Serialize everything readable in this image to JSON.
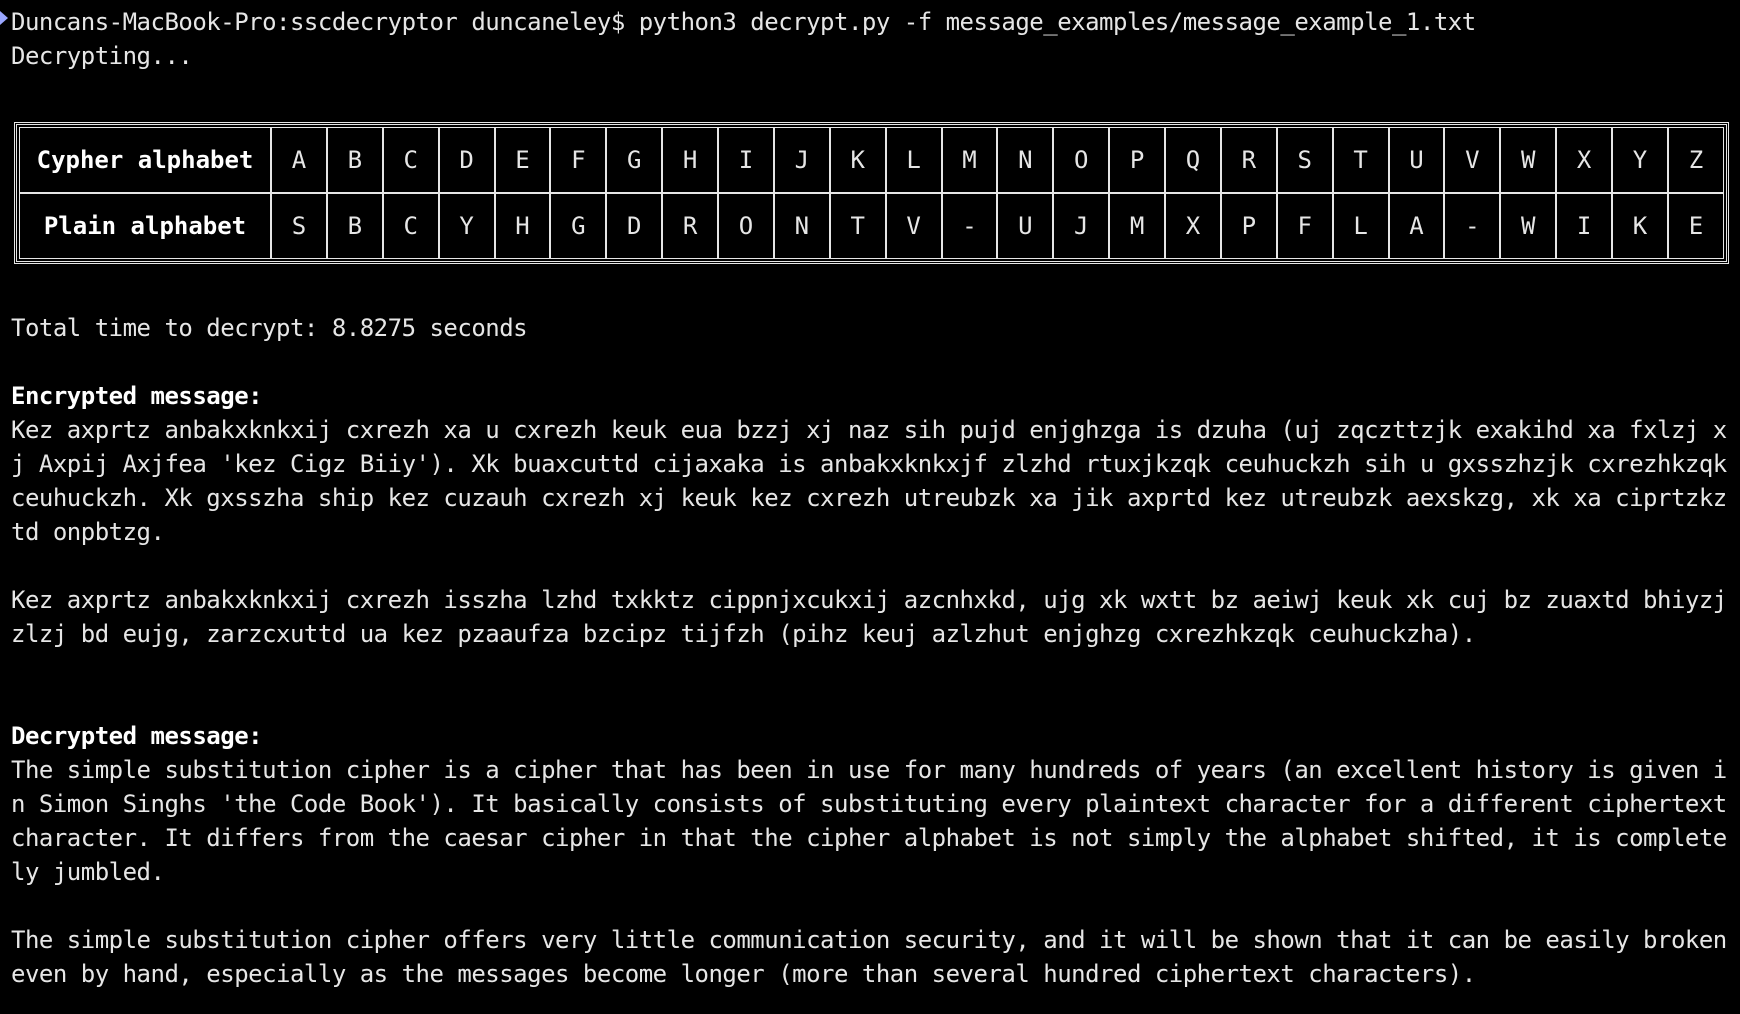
{
  "terminal": {
    "prompt": "Duncans-MacBook-Pro:sscdecryptor duncaneley$ python3 decrypt.py -f message_examples/message_example_1.txt",
    "status": "Decrypting...",
    "table": {
      "row1_label": "Cypher alphabet",
      "row2_label": "Plain alphabet",
      "cypher": [
        "A",
        "B",
        "C",
        "D",
        "E",
        "F",
        "G",
        "H",
        "I",
        "J",
        "K",
        "L",
        "M",
        "N",
        "O",
        "P",
        "Q",
        "R",
        "S",
        "T",
        "U",
        "V",
        "W",
        "X",
        "Y",
        "Z"
      ],
      "plain": [
        "S",
        "B",
        "C",
        "Y",
        "H",
        "G",
        "D",
        "R",
        "O",
        "N",
        "T",
        "V",
        "-",
        "U",
        "J",
        "M",
        "X",
        "P",
        "F",
        "L",
        "A",
        "-",
        "W",
        "I",
        "K",
        "E"
      ]
    },
    "total_time": "Total time to decrypt: 8.8275 seconds",
    "encrypted_heading": "Encrypted message:",
    "encrypted_p1": "Kez axprtz anbakxknkxij cxrezh xa u cxrezh keuk eua bzzj xj naz sih pujd enjghzga is dzuha (uj zqczttzjk exakihd xa fxlzj xj Axpij Axjfea 'kez Cigz Biiy'). Xk buaxcuttd cijaxaka is anbakxknkxjf zlzhd rtuxjkzqk ceuhuckzh sih u gxsszhzjk cxrezhkzqk ceuhuckzh. Xk gxsszha ship kez cuzauh cxrezh xj keuk kez cxrezh utreubzk xa jik axprtd kez utreubzk aexskzg, xk xa ciprtzkztd onpbtzg.",
    "encrypted_p2": "Kez axprtz anbakxknkxij cxrezh isszha lzhd txkktz cippnjxcukxij azcnhxkd, ujg xk wxtt bz aeiwj keuk xk cuj bz zuaxtd bhiyzj zlzj bd eujg, zarzcxuttd ua kez pzaaufza bzcipz tijfzh (pihz keuj azlzhut enjghzg cxrezhkzqk ceuhuckzha).",
    "decrypted_heading": "Decrypted message:",
    "decrypted_p1": "The simple substitution cipher is a cipher that has been in use for many hundreds of years (an excellent history is given in Simon Singhs 'the Code Book'). It basically consists of substituting every plaintext character for a different ciphertext character. It differs from the caesar cipher in that the cipher alphabet is not simply the alphabet shifted, it is completely jumbled.",
    "decrypted_p2": "The simple substitution cipher offers very little communication security, and it will be shown that it can be easily broken even by hand, especially as the messages become longer (more than several hundred ciphertext characters)."
  }
}
